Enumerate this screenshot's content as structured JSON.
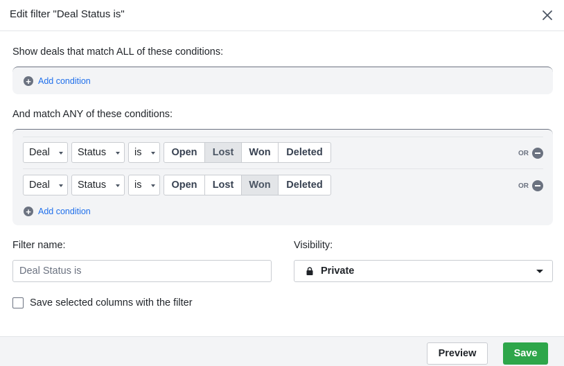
{
  "dialog": {
    "title": "Edit filter \"Deal Status is\"",
    "close_icon": "close-icon"
  },
  "all_section": {
    "label": "Show deals that match ALL of these conditions:",
    "add_label": "Add condition"
  },
  "any_section": {
    "label": "And match ANY of these conditions:",
    "add_label": "Add condition",
    "or_label": "OR",
    "rows": [
      {
        "object": "Deal",
        "field": "Status",
        "operator": "is",
        "options": [
          "Open",
          "Lost",
          "Won",
          "Deleted"
        ],
        "selected": "Lost"
      },
      {
        "object": "Deal",
        "field": "Status",
        "operator": "is",
        "options": [
          "Open",
          "Lost",
          "Won",
          "Deleted"
        ],
        "selected": "Won"
      }
    ]
  },
  "filter_name": {
    "label": "Filter name:",
    "placeholder": "Deal Status is"
  },
  "visibility": {
    "label": "Visibility:",
    "value": "Private",
    "icon": "lock-icon"
  },
  "save_columns": {
    "label": "Save selected columns with the filter",
    "checked": false
  },
  "footer": {
    "preview_label": "Preview",
    "save_label": "Save"
  },
  "colors": {
    "accent_link": "#1f6feb",
    "save_green": "#2ea64a",
    "panel_bg": "#f3f4f6"
  }
}
